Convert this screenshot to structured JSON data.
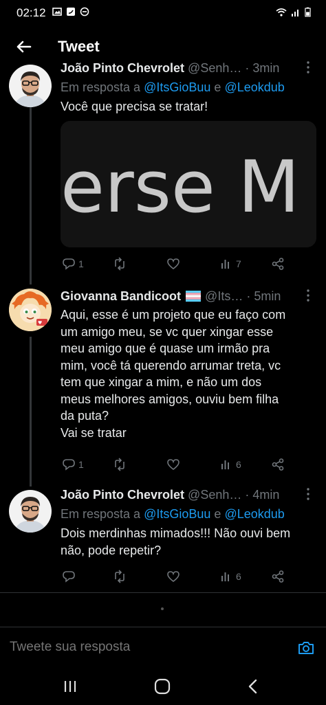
{
  "status_bar": {
    "time": "02:12",
    "left_icons": [
      "image-icon",
      "twitter-icon",
      "do-not-disturb-icon"
    ],
    "right_icons": [
      "wifi-icon",
      "signal-icon",
      "battery-icon"
    ]
  },
  "header": {
    "title": "Tweet"
  },
  "colors": {
    "background": "#000000",
    "accent": "#1d9bf0",
    "muted": "#71767b",
    "text": "#e7e9ea"
  },
  "tweets": [
    {
      "name": "João Pinto Chevrolet",
      "handle": "@Senh…",
      "time": "3min",
      "reply_prefix": "Em resposta a",
      "mention1": "@ItsGioBuu",
      "conj": "e",
      "mention2": "@Leokdub",
      "text": "Você que precisa se tratar!",
      "media_text": "erse M",
      "actions": {
        "replies": "1",
        "retweets": "",
        "likes": "",
        "views": "7"
      }
    },
    {
      "name": "Giovanna Bandicoot",
      "handle": "@Its…",
      "time": "5min",
      "lines": [
        "Aqui, esse é um projeto que eu faço com",
        "um amigo meu, se vc quer xingar esse",
        "meu amigo que é quase um irmão pra",
        "mim, você tá querendo arrumar treta, vc",
        "tem que xingar a mim, e não um dos",
        "meus melhores amigos, ouviu bem filha",
        "da puta?",
        "Vai se tratar"
      ],
      "actions": {
        "replies": "1",
        "retweets": "",
        "likes": "",
        "views": "6"
      }
    },
    {
      "name": "João Pinto Chevrolet",
      "handle": "@Senh…",
      "time": "4min",
      "reply_prefix": "Em resposta a",
      "mention1": "@ItsGioBuu",
      "conj": "e",
      "mention2": "@Leokdub",
      "lines": [
        "Dois merdinhas mimados!!! Não ouvi bem",
        "não, pode repetir?"
      ],
      "actions": {
        "replies": "",
        "retweets": "",
        "likes": "",
        "views": "6"
      }
    }
  ],
  "compose": {
    "placeholder": "Tweete sua resposta"
  },
  "nav_bar": {
    "icons": [
      "recent-apps-icon",
      "home-icon",
      "back-icon"
    ]
  }
}
